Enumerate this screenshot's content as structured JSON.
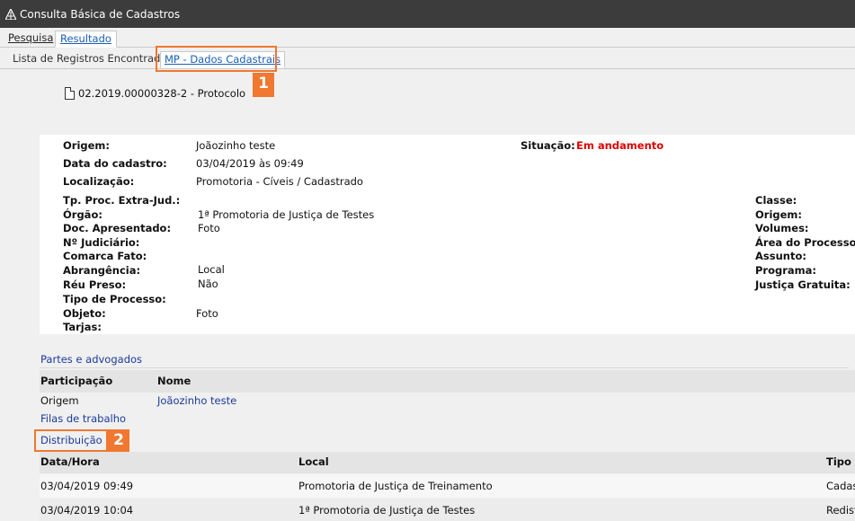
{
  "window": {
    "title": "Consulta Básica de Cadastros",
    "icon": "app-logo-icon"
  },
  "main_tabs": [
    {
      "label": "Pesquisa"
    },
    {
      "label": "Resultado"
    }
  ],
  "sub_tabs": [
    {
      "label": "Lista de Registros Encontrados"
    },
    {
      "label": "MP - Dados Cadastrais"
    }
  ],
  "callouts": [
    "1",
    "2"
  ],
  "protocol": {
    "icon": "document-icon",
    "text": "02.2019.00000328-2 - Protocolo"
  },
  "details": {
    "origem_label": "Origem:",
    "origem_value": "Joãozinho teste",
    "situacao_label": "Situação:",
    "situacao_value": "Em andamento",
    "data_cadastro_label": "Data do cadastro:",
    "data_cadastro_value": "03/04/2019 às 09:49",
    "localizacao_label": "Localização:",
    "localizacao_value": "Promotoria - Cíveis / Cadastrado",
    "tp_proc_label": "Tp. Proc. Extra-Jud.:",
    "orgao_label": "Órgão:",
    "orgao_value": "1ª Promotoria de Justiça de Testes",
    "doc_label": "Doc. Apresentado:",
    "doc_value": "Foto",
    "num_judiciario_label": "Nº Judiciário:",
    "comarca_label": "Comarca Fato:",
    "abrangencia_label": "Abrangência:",
    "abrangencia_value": "Local",
    "reu_preso_label": "Réu Preso:",
    "reu_preso_value": "Não",
    "tipo_processo_label": "Tipo de Processo:",
    "objeto_label": "Objeto:",
    "objeto_value": "Foto",
    "tarjas_label": "Tarjas:",
    "right_labels": [
      "Classe:",
      "Origem:",
      "Volumes:",
      "Área do Processo:",
      "Assunto:",
      "Programa:",
      "Justiça Gratuita:"
    ]
  },
  "partes": {
    "link": "Partes e advogados",
    "headers": [
      "Participação",
      "Nome"
    ],
    "rows": [
      {
        "participacao": "Origem",
        "nome": "Joãozinho teste"
      }
    ]
  },
  "filas_link": "Filas de trabalho",
  "distribuicao": {
    "link": "Distribuição",
    "headers": [
      "Data/Hora",
      "Local",
      "Tipo"
    ],
    "rows": [
      {
        "data": "03/04/2019 09:49",
        "local": "Promotoria de Justiça de Treinamento",
        "tipo": "Cadas"
      },
      {
        "data": "03/04/2019 10:04",
        "local": "1ª Promotoria de Justiça de Testes",
        "tipo": "Redist"
      }
    ]
  },
  "colors": {
    "accent": "#f07830",
    "link": "#1a3a9a",
    "status_red": "#dd0000",
    "titlebar": "#3c3c3c"
  }
}
